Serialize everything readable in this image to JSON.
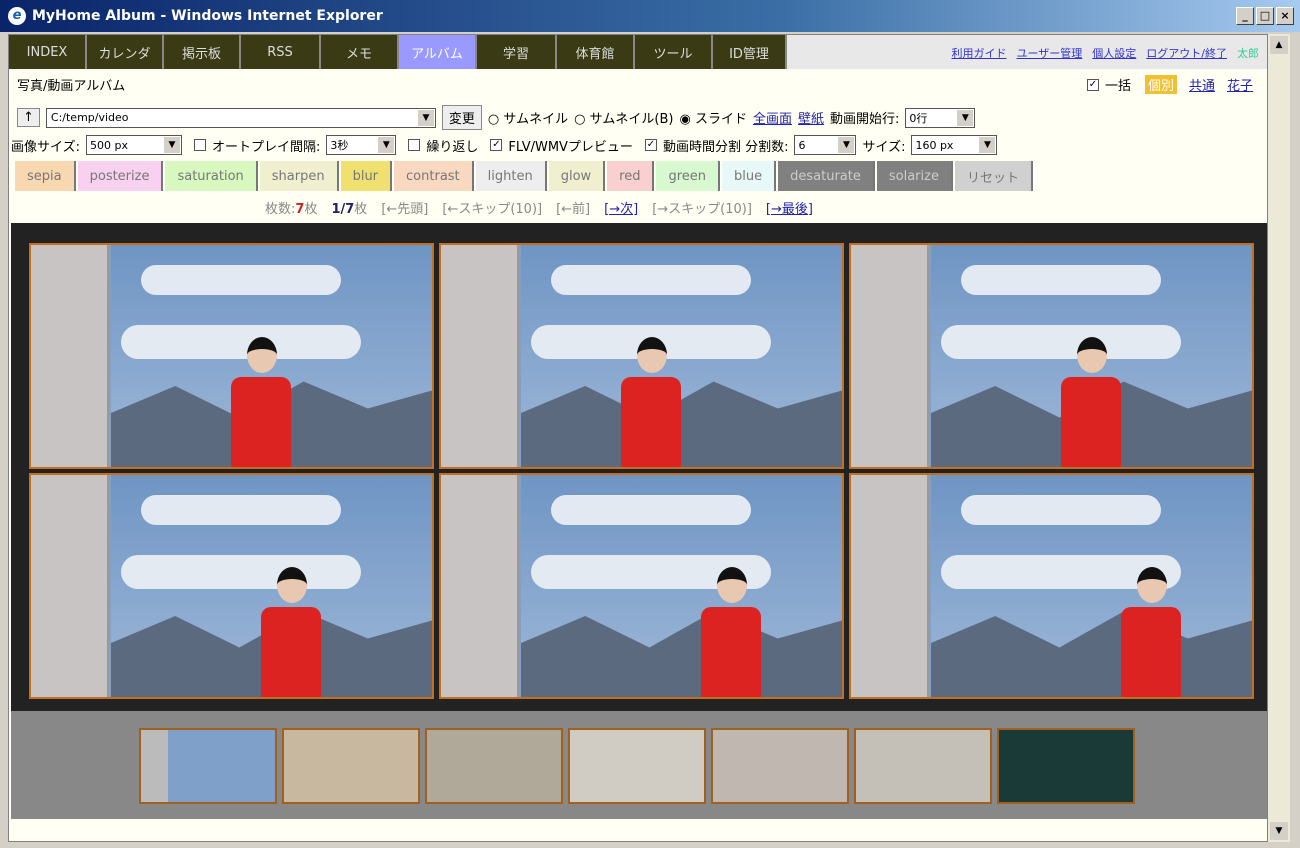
{
  "window": {
    "title": "MyHome Album - Windows Internet Explorer",
    "controls": [
      "_",
      "□",
      "×"
    ]
  },
  "nav": {
    "tabs": [
      "INDEX",
      "カレンダ",
      "掲示板",
      "RSS",
      "メモ",
      "アルバム",
      "学習",
      "体育館",
      "ツール",
      "ID管理"
    ],
    "active": "アルバム",
    "links": [
      "利用ガイド",
      "ユーザー管理",
      "個人設定",
      "ログアウト/終了"
    ],
    "user": "太郎"
  },
  "header": {
    "title": "写真/動画アルバム",
    "all_label": "一括",
    "scopes": [
      "個別",
      "共通",
      "花子"
    ]
  },
  "path": {
    "up": "↑",
    "value": "C:/temp/video",
    "change": "変更",
    "modes": [
      "サムネイル",
      "サムネイル(B)",
      "スライド"
    ],
    "selected_mode": "スライド",
    "fullscreen": "全画面",
    "wallpaper": "壁紙",
    "start_label": "動画開始行:",
    "start_value": "0行"
  },
  "options": {
    "size_label": "画像サイズ:",
    "size_value": "500 px",
    "autoplay": "オートプレイ間隔:",
    "autoplay_value": "3秒",
    "repeat": "繰り返し",
    "flv": "FLV/WMVプレビュー",
    "split": "動画時間分割 分割数:",
    "split_value": "6",
    "thumb_size_label": "サイズ:",
    "thumb_size_value": "160 px"
  },
  "effects": [
    {
      "label": "sepia",
      "color": "#f8d8b0"
    },
    {
      "label": "posterize",
      "color": "#f8d0f0"
    },
    {
      "label": "saturation",
      "color": "#d8f8c0"
    },
    {
      "label": "sharpen",
      "color": "#f0f0d0"
    },
    {
      "label": "blur",
      "color": "#f0e070"
    },
    {
      "label": "contrast",
      "color": "#f8d8c0"
    },
    {
      "label": "lighten",
      "color": "#eeeeee"
    },
    {
      "label": "glow",
      "color": "#f0f0d0"
    },
    {
      "label": "red",
      "color": "#f8d0d0"
    },
    {
      "label": "green",
      "color": "#d8f8d0"
    },
    {
      "label": "blue",
      "color": "#e8f8f8"
    },
    {
      "label": "desaturate",
      "color": "#808080"
    },
    {
      "label": "solarize",
      "color": "#808080"
    },
    {
      "label": "リセット",
      "color": "#d0d0d0"
    }
  ],
  "pager": {
    "count_label": "枚数:",
    "count": "7",
    "count_unit": "枚",
    "position": "1/7",
    "pos_unit": "枚",
    "first": "[←先頭]",
    "skip_back": "[←スキップ(10)]",
    "prev": "[←前]",
    "next": "[→次]",
    "skip_fwd": "[→スキップ(10)]",
    "last": "[→最後]"
  }
}
